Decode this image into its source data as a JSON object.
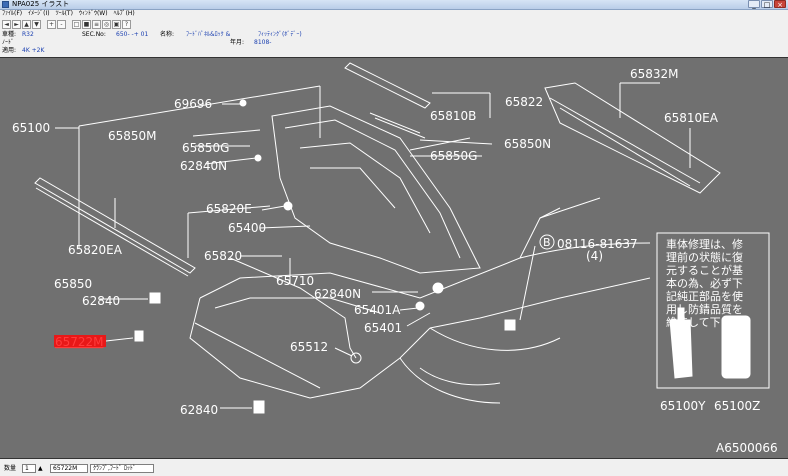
{
  "window": {
    "title": "NPA025 イラスト"
  },
  "menu": [
    "ﾌｧｲﾙ(F)",
    "ｲﾒｰｼﾞ(I)",
    "ﾂｰﾙ(T)",
    "ｳｨﾝﾄﾞｳ(W)",
    "ﾍﾙﾌﾟ(H)"
  ],
  "toolbar_buttons": [
    "◄",
    "►",
    "▲",
    "▼",
    "+",
    "-",
    "□",
    "■",
    "≡",
    "◎",
    "▣",
    "?"
  ],
  "info": {
    "model_label": "車種:",
    "model_value": "R32",
    "sec_label": "SEC.No:",
    "sec_value": "650-  -+ 01",
    "name_label": "名称:",
    "name_value": "ﾌｰﾄﾞﾊﾟﾈﾙ&ﾛｯｸ &",
    "name2_value": "ﾌｨｯﾃｨﾝｸﾞ(ﾎﾞﾃﾞｰ)",
    "year_label": "年月:",
    "year_value": "8108-",
    "sub_label": "ﾉｰﾄﾞ",
    "apply_label": "適用:",
    "apply_value": "4K +2K"
  },
  "diagram": {
    "parts": [
      {
        "code": "65100",
        "highlight": false
      },
      {
        "code": "69696",
        "highlight": false
      },
      {
        "code": "65850M",
        "highlight": false
      },
      {
        "code": "65850G",
        "highlight": false
      },
      {
        "code": "62840N",
        "highlight": false
      },
      {
        "code": "65820E",
        "highlight": false
      },
      {
        "code": "65400",
        "highlight": false
      },
      {
        "code": "65820",
        "highlight": false
      },
      {
        "code": "65820EA",
        "highlight": false
      },
      {
        "code": "65850",
        "highlight": false
      },
      {
        "code": "62840",
        "highlight": false
      },
      {
        "code": "65722M",
        "highlight": true
      },
      {
        "code": "65710",
        "highlight": false
      },
      {
        "code": "62840N",
        "highlight": false
      },
      {
        "code": "65401A",
        "highlight": false
      },
      {
        "code": "65401",
        "highlight": false
      },
      {
        "code": "65512",
        "highlight": false
      },
      {
        "code": "62840",
        "highlight": false
      },
      {
        "code": "65822",
        "highlight": false
      },
      {
        "code": "65810B",
        "highlight": false
      },
      {
        "code": "65850N",
        "highlight": false
      },
      {
        "code": "65850G",
        "highlight": false
      },
      {
        "code": "65832M",
        "highlight": false
      },
      {
        "code": "65810EA",
        "highlight": false
      },
      {
        "code": "08116-81637",
        "highlight": false
      },
      {
        "code": "(4)",
        "highlight": false
      },
      {
        "code": "65100Y",
        "highlight": false
      },
      {
        "code": "65100Z",
        "highlight": false
      }
    ],
    "bolt_symbol": "B",
    "note_lines": [
      "車体修理は、修",
      "理前の状態に復",
      "元することが基",
      "本の為、必ず下",
      "記純正部品を使",
      "用し防錆品質を",
      "維持して下さい。"
    ],
    "figure_id": "A6500066"
  },
  "status": {
    "qty_label": "数量",
    "qty_value": "1",
    "part_no": "65722M",
    "part_name": "ｸﾗﾝﾌﾟ,ﾌｰﾄﾞ ﾛｯﾄﾞ"
  }
}
